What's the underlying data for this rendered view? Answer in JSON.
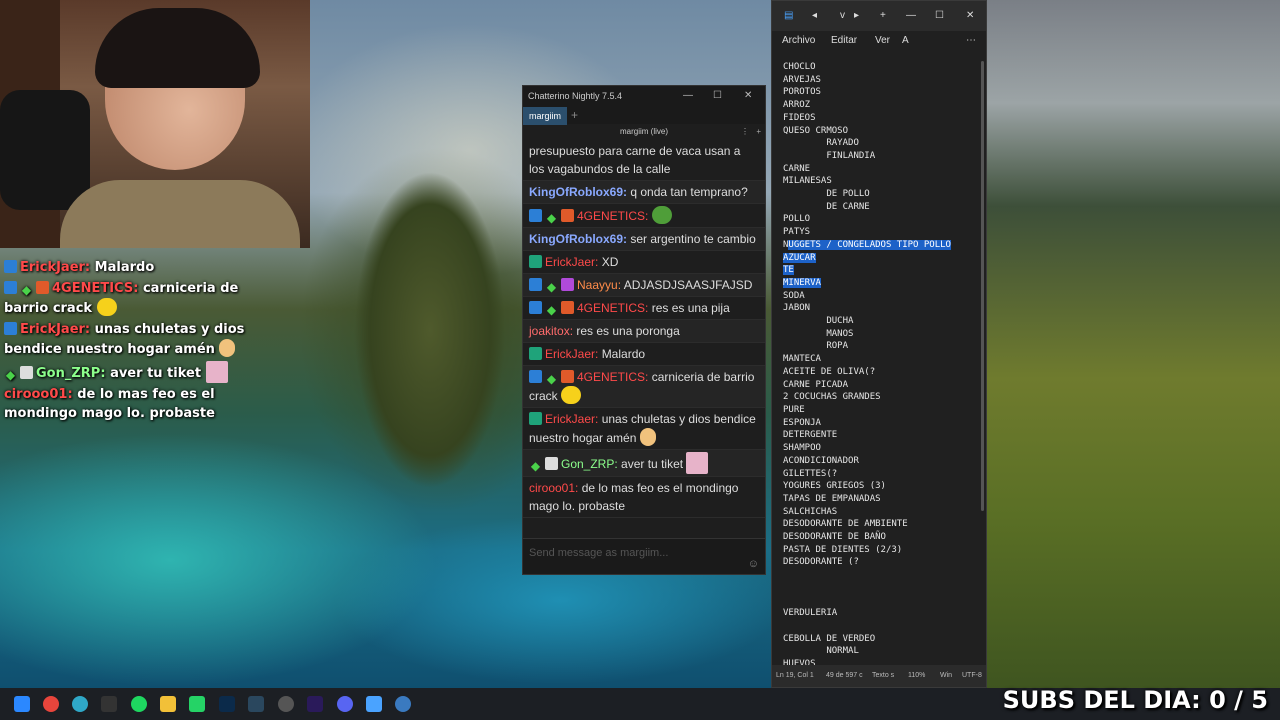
{
  "overlay_chat": [
    {
      "user": "ErickJaer:",
      "user_color": "#ff4a4a",
      "badges": [
        "mod"
      ],
      "text": "Malardo"
    },
    {
      "user": "4GENETICS:",
      "user_color": "#ff4a4a",
      "badges": [
        "mod",
        "star",
        "sub"
      ],
      "text": "carniceria de barrio crack",
      "emote": "smug"
    },
    {
      "user": "ErickJaer:",
      "user_color": "#ff4a4a",
      "badges": [
        "mod"
      ],
      "text": "unas chuletas y dios bendice nuestro hogar amén",
      "emote": "hands"
    },
    {
      "user": "Gon_ZRP:",
      "user_color": "#8cff8c",
      "badges": [
        "star",
        "prime"
      ],
      "text": "aver tu tiket",
      "emote": "pic"
    },
    {
      "user": "cirooo01:",
      "user_color": "#ff4a4a",
      "badges": [],
      "text": "de lo mas feo es el mondingo mago lo. probaste"
    }
  ],
  "chatterino": {
    "title": "Chatterino Nightly 7.5.4",
    "tab": "margiim",
    "channel": "margiim (live)",
    "input_placeholder": "Send message as margiim...",
    "messages": [
      {
        "user": "",
        "text": "presupuesto para carne de vaca usan a los vagabundos de la calle"
      },
      {
        "user": "KingOfRoblox69:",
        "text": "q onda tan temprano?"
      },
      {
        "user": "4GENETICS:",
        "text": ""
      },
      {
        "user": "KingOfRoblox69:",
        "text": "ser argentino te cambio"
      },
      {
        "user": "ErickJaer:",
        "text": "XD"
      },
      {
        "user": "Naayyu:",
        "text": "ADJASDJSAASJFAJSD"
      },
      {
        "user": "4GENETICS:",
        "text": "res es una pija"
      },
      {
        "user": "joakitox:",
        "text": "res es una poronga"
      },
      {
        "user": "ErickJaer:",
        "text": "Malardo"
      },
      {
        "user": "4GENETICS:",
        "text": "carniceria de barrio crack"
      },
      {
        "user": "ErickJaer:",
        "text": "unas chuletas y dios bendice nuestro hogar amén"
      },
      {
        "user": "Gon_ZRP:",
        "text": "aver tu tiket"
      },
      {
        "user": "cirooo01:",
        "text": "de lo mas feo es el mondingo mago lo. probaste"
      }
    ]
  },
  "notepad": {
    "menu": [
      "Archivo",
      "Editar",
      "Ver"
    ],
    "status": {
      "position": "Ln 19, Col 1",
      "selection": "49 de 597 c",
      "text": "Texto s",
      "zoom": "110%",
      "eol": "Win",
      "encoding": "UTF-8"
    },
    "lines_before": "CHOCLO\nARVEJAS\nPOROTOS\nARROZ\nFIDEOS\nQUESO CRMOSO\n        RAYADO\n        FINLANDIA\nCARNE\nMILANESAS\n        DE POLLO\n        DE CARNE\nPOLLO\nPATYS\nN",
    "selected": "UGGETS / CONGELADOS TIPO POLLO\nAZUCAR\nTE\nMINERVA",
    "lines_after": "\nSODA\nJABON\n        DUCHA\n        MANOS\n        ROPA\nMANTECA\nACEITE DE OLIVA(?\nCARNE PICADA\n2 COCUCHAS GRANDES\nPURE\nESPONJA\nDETERGENTE\nSHAMPOO\nACONDICIONADOR\nGILETTES(?\nYOGURES GRIEGOS (3)\nTAPAS DE EMPANADAS\nSALCHICHAS\nDESODORANTE DE AMBIENTE\nDESODORANTE DE BAÑO\nPASTA DE DIENTES (2/3)\nDESODORANTE (?\n\n\n\nVERDULERIA\n\nCEBOLLA DE VERDEO\n        NORMAL\nHUEVOS"
  },
  "subs_text": "SUBS DEL DIA: 0 / 5",
  "taskbar_icons": [
    "windows-start-icon",
    "chrome-icon",
    "edge-icon",
    "obs-icon",
    "spotify-icon",
    "file-explorer-icon",
    "whatsapp-icon",
    "photoshop-icon",
    "steam-icon",
    "settings-icon",
    "premiere-icon",
    "discord-icon",
    "notepad-icon",
    "chatterino-icon"
  ]
}
